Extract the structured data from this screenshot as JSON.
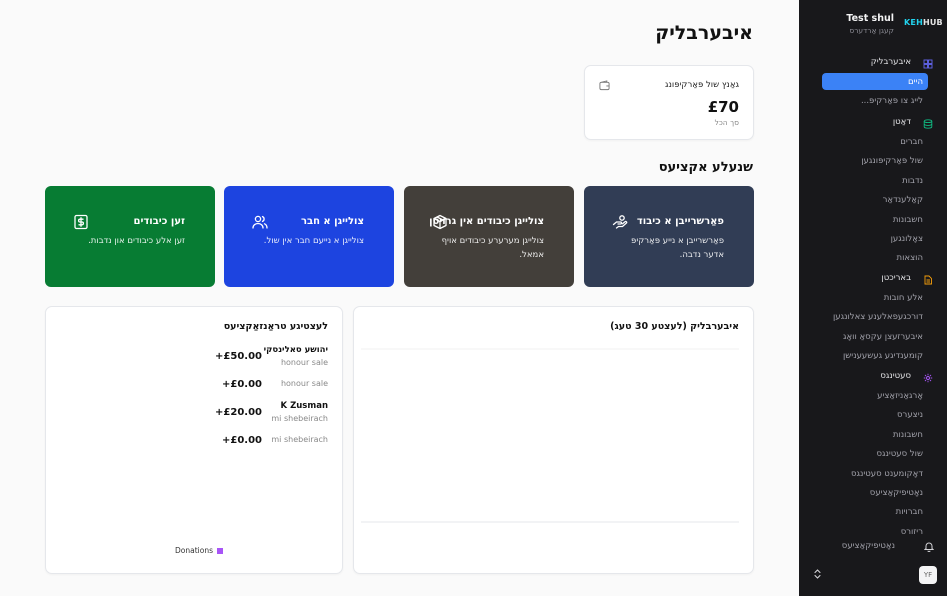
{
  "page": {
    "title": "איבערבליק"
  },
  "stat": {
    "label": "גאַנץ שול פּאַרקיפּונג",
    "amount": "£70",
    "sub": "סך הכל"
  },
  "quick": {
    "title": "שנעלע אקציעס",
    "actions": [
      {
        "title": "פאַרשרייבן א כיבוד",
        "desc": "פאַרשרייבן א נייע פּאַרקיפּ אדער נדבה.",
        "color": "#313d55",
        "icon": "hand-coins-icon"
      },
      {
        "title": "צולייגן כיבודים אין גרויסן",
        "desc": "צולייגן מערערע כיבודים אויף אמאל.",
        "color": "#433f3a",
        "icon": "package-icon"
      },
      {
        "title": "צולייגן א חבר",
        "desc": "צולייגן א נייעם חבר אין שול.",
        "color": "#1d44e0",
        "icon": "users-icon"
      },
      {
        "title": "זען כיבודים",
        "desc": "זען אלע כיבודים און נדבות.",
        "color": "#077c33",
        "icon": "dollar-icon"
      }
    ]
  },
  "transactions": {
    "title": "לעצטיגע טראַנזאַקציעס",
    "rows": [
      {
        "name": "יהושע סאלינסקי",
        "type": "honour sale",
        "amount": "£50.00+"
      },
      {
        "name": "",
        "type": "honour sale",
        "amount": "£0.00+"
      },
      {
        "name": "K Zusman",
        "type": "mi shebeirach",
        "amount": "£20.00+"
      },
      {
        "name": "",
        "type": "mi shebeirach",
        "amount": "£0.00+"
      }
    ]
  },
  "chart": {
    "title": "איבערבליק (לעצטע 30 טעג)",
    "legend": "Donations",
    "legend_color": "#a855f7"
  },
  "chart_data": {
    "type": "line",
    "title": "איבערבליק (לעצטע 30 טעג)",
    "series": [
      {
        "name": "Donations",
        "values": []
      }
    ],
    "x": [],
    "grid": true,
    "legend": "bottom"
  },
  "sidebar": {
    "org_name": "Test shul",
    "org_sub": "קעגן אַרדערס",
    "logo_a": "KEH",
    "logo_b": "HUB",
    "groups": [
      {
        "label": "איבערבליק",
        "icon": "grid-icon",
        "color": "#6366f1",
        "items": [
          "היים",
          "לייג צו פּאַרקיפּ..."
        ]
      },
      {
        "label": "דאַטן",
        "icon": "database-icon",
        "color": "#10b981",
        "items": [
          "חברים",
          "שול פּאַרקיפּונגען",
          "נדבות",
          "קאַלענדאַר",
          "חשבונות",
          "צאָלונגען",
          "הוצאות"
        ]
      },
      {
        "label": "באריכטן",
        "icon": "file-icon",
        "color": "#f59e0b",
        "items": [
          "אלע חובות",
          "דורכגעפאלענע צאלונגען",
          "איבערזעצן עקסאַ וואָג",
          "קומענדיגע געשעענישן"
        ]
      },
      {
        "label": "סעטינגס",
        "icon": "gear-icon",
        "color": "#a855f7",
        "items": [
          "אָרגאַניזאַציע",
          "ניצערס",
          "חשבונות",
          "שול סעטינגס",
          "דאָקומענט סעטינגס",
          "נאָטיפיקאַציעס",
          "חברויות",
          "ריזורס"
        ]
      }
    ],
    "footer_label": "נאָטיפיקאַציעס",
    "avatar": "YF"
  }
}
